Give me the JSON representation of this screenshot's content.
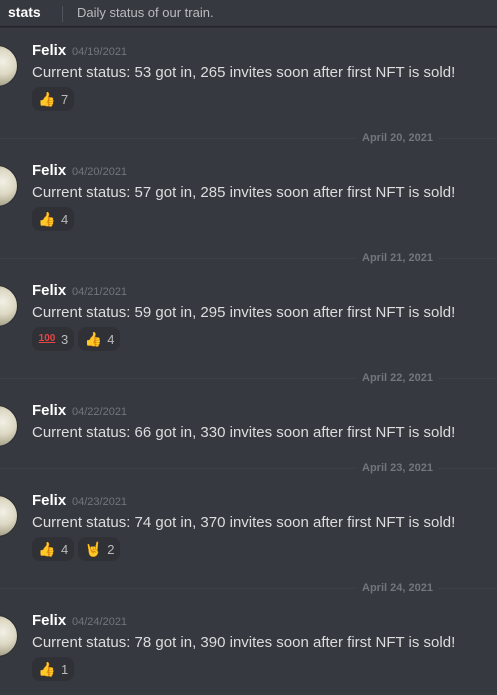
{
  "channel": {
    "name": "stats",
    "topic": "Daily status of our train."
  },
  "messages": [
    {
      "author": "Felix",
      "timestamp": "04/19/2021",
      "content": "Current status: 53 got in, 265 invites soon after first NFT is sold!",
      "reactions": [
        {
          "emoji": "thumbs-up",
          "count": "7"
        }
      ]
    },
    {
      "author": "Felix",
      "timestamp": "04/20/2021",
      "content": "Current status: 57 got in, 285 invites soon after first NFT is sold!",
      "reactions": [
        {
          "emoji": "thumbs-up",
          "count": "4"
        }
      ]
    },
    {
      "author": "Felix",
      "timestamp": "04/21/2021",
      "content": "Current status: 59 got in, 295 invites soon after first NFT is sold!",
      "reactions": [
        {
          "emoji": "hundred-points",
          "count": "3"
        },
        {
          "emoji": "thumbs-up",
          "count": "4"
        }
      ]
    },
    {
      "author": "Felix",
      "timestamp": "04/22/2021",
      "content": "Current status: 66 got in, 330 invites soon after first NFT is sold!",
      "reactions": []
    },
    {
      "author": "Felix",
      "timestamp": "04/23/2021",
      "content": "Current status: 74 got in, 370 invites soon after first NFT is sold!",
      "reactions": [
        {
          "emoji": "thumbs-up",
          "count": "4"
        },
        {
          "emoji": "sign-of-the-horns",
          "count": "2"
        }
      ]
    },
    {
      "author": "Felix",
      "timestamp": "04/24/2021",
      "content": "Current status: 78 got in, 390 invites soon after first NFT is sold!",
      "reactions": [
        {
          "emoji": "thumbs-up",
          "count": "1"
        }
      ]
    }
  ],
  "date_dividers": [
    "April 20, 2021",
    "April 21, 2021",
    "April 22, 2021",
    "April 23, 2021",
    "April 24, 2021"
  ],
  "colors": {
    "background": "#36393f",
    "username": "#ffffff",
    "timestamp": "#72767d",
    "reaction_bg": "#2f3136"
  }
}
